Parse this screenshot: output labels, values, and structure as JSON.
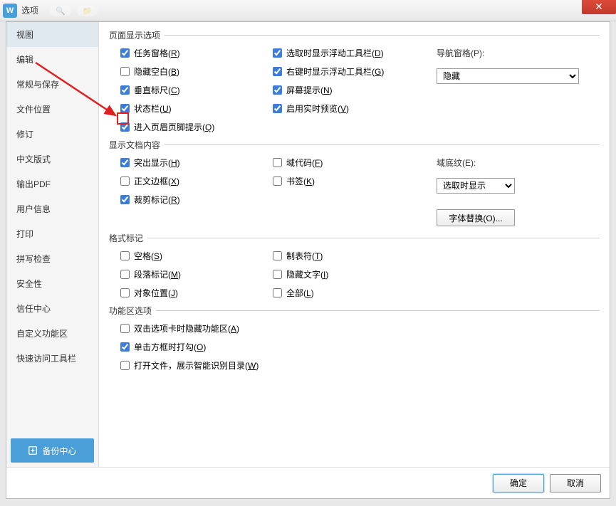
{
  "window": {
    "title": "选项",
    "close": "✕"
  },
  "sidebar": {
    "items": [
      {
        "label": "视图",
        "selected": true
      },
      {
        "label": "编辑"
      },
      {
        "label": "常规与保存"
      },
      {
        "label": "文件位置"
      },
      {
        "label": "修订"
      },
      {
        "label": "中文版式"
      },
      {
        "label": "输出PDF"
      },
      {
        "label": "用户信息"
      },
      {
        "label": "打印"
      },
      {
        "label": "拼写检查"
      },
      {
        "label": "安全性"
      },
      {
        "label": "信任中心"
      },
      {
        "label": "自定义功能区"
      },
      {
        "label": "快速访问工具栏"
      }
    ],
    "backup_label": "备份中心"
  },
  "groups": {
    "page_display": {
      "legend": "页面显示选项",
      "col1": [
        {
          "checked": true,
          "label": "任务窗格(R)"
        },
        {
          "checked": false,
          "label": "隐藏空白(B)"
        },
        {
          "checked": true,
          "label": "垂直标尺(C)"
        },
        {
          "checked": true,
          "label": "状态栏(U)"
        },
        {
          "checked": true,
          "label": "进入页眉页脚提示(Q)",
          "highlight": true
        }
      ],
      "col2": [
        {
          "checked": true,
          "label": "选取时显示浮动工具栏(D)"
        },
        {
          "checked": true,
          "label": "右键时显示浮动工具栏(G)"
        },
        {
          "checked": true,
          "label": "屏幕提示(N)"
        },
        {
          "checked": true,
          "label": "启用实时预览(V)"
        }
      ],
      "nav_label": "导航窗格(P):",
      "nav_value": "隐藏"
    },
    "doc_content": {
      "legend": "显示文档内容",
      "col1": [
        {
          "checked": true,
          "label": "突出显示(H)"
        },
        {
          "checked": false,
          "label": "正文边框(X)"
        },
        {
          "checked": true,
          "label": "裁剪标记(R)"
        }
      ],
      "col2": [
        {
          "checked": false,
          "label": "域代码(F)"
        },
        {
          "checked": false,
          "label": "书签(K)"
        }
      ],
      "shade_label": "域底纹(E):",
      "shade_value": "选取时显示",
      "font_sub_label": "字体替换(O)..."
    },
    "format_marks": {
      "legend": "格式标记",
      "col1": [
        {
          "checked": false,
          "label": "空格(S)"
        },
        {
          "checked": false,
          "label": "段落标记(M)"
        },
        {
          "checked": false,
          "label": "对象位置(J)"
        }
      ],
      "col2": [
        {
          "checked": false,
          "label": "制表符(T)"
        },
        {
          "checked": false,
          "label": "隐藏文字(I)"
        },
        {
          "checked": false,
          "label": "全部(L)"
        }
      ]
    },
    "ribbon": {
      "legend": "功能区选项",
      "items": [
        {
          "checked": false,
          "label": "双击选项卡时隐藏功能区(A)"
        },
        {
          "checked": true,
          "label": "单击方框时打勾(O)"
        },
        {
          "checked": false,
          "label": "打开文件，展示智能识别目录(W)"
        }
      ]
    }
  },
  "footer": {
    "ok": "确定",
    "cancel": "取消"
  }
}
